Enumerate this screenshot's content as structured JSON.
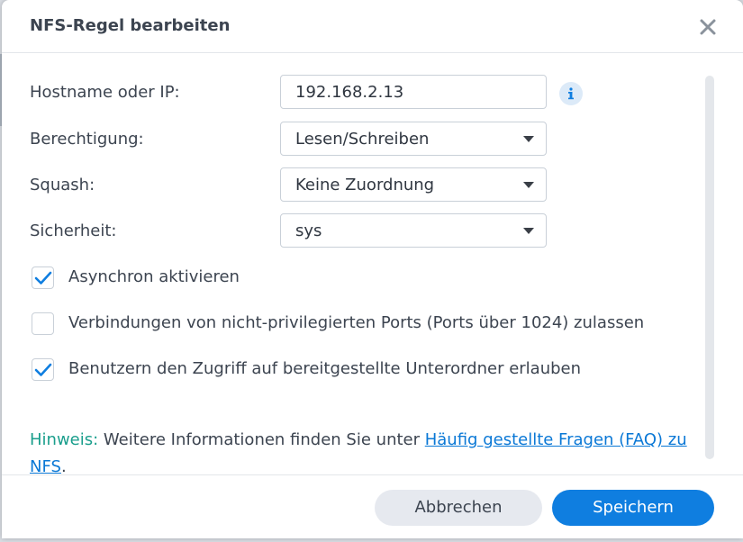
{
  "dialog": {
    "title": "NFS-Regel bearbeiten"
  },
  "form": {
    "hostname": {
      "label": "Hostname oder IP:",
      "value": "192.168.2.13"
    },
    "permission": {
      "label": "Berechtigung:",
      "value": "Lesen/Schreiben"
    },
    "squash": {
      "label": "Squash:",
      "value": "Keine Zuordnung"
    },
    "security": {
      "label": "Sicherheit:",
      "value": "sys"
    }
  },
  "checkboxes": [
    {
      "label": "Asynchron aktivieren",
      "checked": true
    },
    {
      "label": "Verbindungen von nicht-privilegierten Ports (Ports über 1024) zulassen",
      "checked": false
    },
    {
      "label": "Benutzern den Zugriff auf bereitgestellte Unterordner erlauben",
      "checked": true
    }
  ],
  "hint": {
    "prefix": "Hinweis:",
    "text": " Weitere Informationen finden Sie unter ",
    "link": "Häufig gestellte Fragen (FAQ) zu NFS",
    "suffix": "."
  },
  "buttons": {
    "cancel": "Abbrechen",
    "save": "Speichern"
  },
  "colors": {
    "accent": "#0f7ee0",
    "hint": "#1a9e8c",
    "link": "#0a78d6"
  }
}
